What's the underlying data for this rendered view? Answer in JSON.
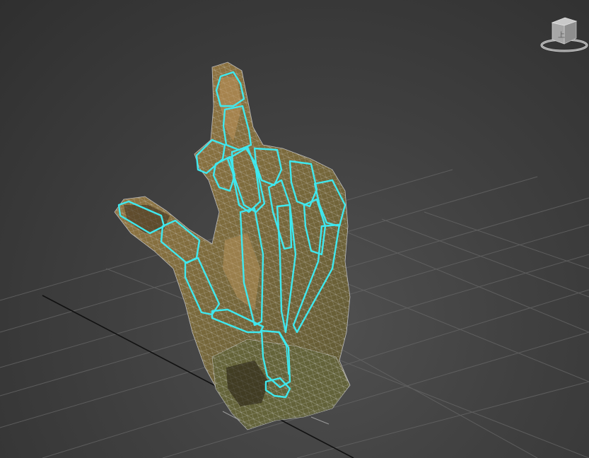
{
  "viewport": {
    "background": "#3d3d3d",
    "grid_color": "#6a6a6a",
    "axis_color": "#111111",
    "skin_color": "#8a7446",
    "wire_color": "#cfcfcf",
    "bone_color": "#3fe8ee"
  },
  "viewcube": {
    "icon": "viewcube-icon",
    "face_label": "上"
  },
  "model": {
    "icon": "hand-mesh",
    "bones_icon": "bone-rig"
  }
}
